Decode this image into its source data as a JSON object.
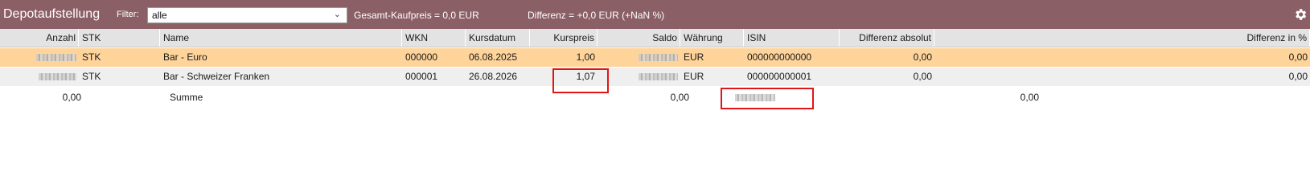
{
  "header": {
    "title": "Depotaufstellung",
    "filter_label": "Filter:",
    "filter_value": "alle",
    "gesamt_kaufpreis": "Gesamt-Kaufpreis = 0,0 EUR",
    "differenz": "Differenz = +0,0 EUR (+NaN %)",
    "settings_icon": "gear-icon"
  },
  "columns": [
    "Anzahl",
    "STK",
    "Name",
    "WKN",
    "Kursdatum",
    "Kurspreis",
    "Saldo",
    "Währung",
    "ISIN",
    "Differenz absolut",
    "Differenz in %"
  ],
  "rows": [
    {
      "stk": "STK",
      "name": "Bar - Euro",
      "wkn": "000000",
      "kursdatum": "06.08.2025",
      "kurspreis": "1,00",
      "waehrung": "EUR",
      "isin": "000000000000",
      "diff_abs": "0,00",
      "diff_pct": "0,00"
    },
    {
      "stk": "STK",
      "name": "Bar - Schweizer Franken",
      "wkn": "000001",
      "kursdatum": "26.08.2026",
      "kurspreis": "1,07",
      "waehrung": "EUR",
      "isin": "000000000001",
      "diff_abs": "0,00",
      "diff_pct": "0,00"
    }
  ],
  "summary": {
    "anzahl": "0,00",
    "label": "Summe",
    "saldo": "0,00",
    "diff": "0,00"
  },
  "colors": {
    "header_bg": "#8b5f66",
    "selected_row": "#ffd49a",
    "alt_row": "#efefef",
    "highlight_border": "#e01515"
  }
}
